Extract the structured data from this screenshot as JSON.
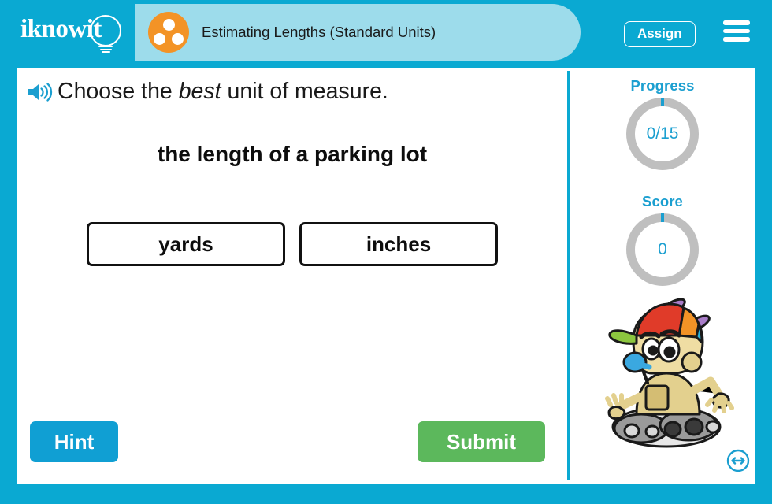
{
  "brand": {
    "logo_text": "iknowit",
    "logo_icon": "lightbulb-icon",
    "accent_blue": "#0aa9d2",
    "title_pill_blue": "#9ddceb",
    "badge_orange": "#f39326",
    "submit_green": "#5cb85c",
    "ring_gray": "#bfbfbf"
  },
  "header": {
    "title": "Estimating Lengths (Standard Units)",
    "badge_icon": "three-dots-circle-icon",
    "assign_label": "Assign",
    "menu_icon": "hamburger-menu-icon"
  },
  "question": {
    "audio_icon": "speaker-icon",
    "prompt_before": "Choose the ",
    "prompt_emphasis": "best",
    "prompt_after": " unit of measure.",
    "stem": "the length of a parking lot",
    "choices": [
      {
        "label": "yards"
      },
      {
        "label": "inches"
      }
    ]
  },
  "actions": {
    "hint_label": "Hint",
    "submit_label": "Submit"
  },
  "sidebar": {
    "progress": {
      "label": "Progress",
      "value": "0/15",
      "completed": 0,
      "total": 15
    },
    "score": {
      "label": "Score",
      "value": "0"
    },
    "mascot_icon": "robot-mascot-propeller-hat",
    "resize_icon": "horizontal-resize-icon"
  }
}
